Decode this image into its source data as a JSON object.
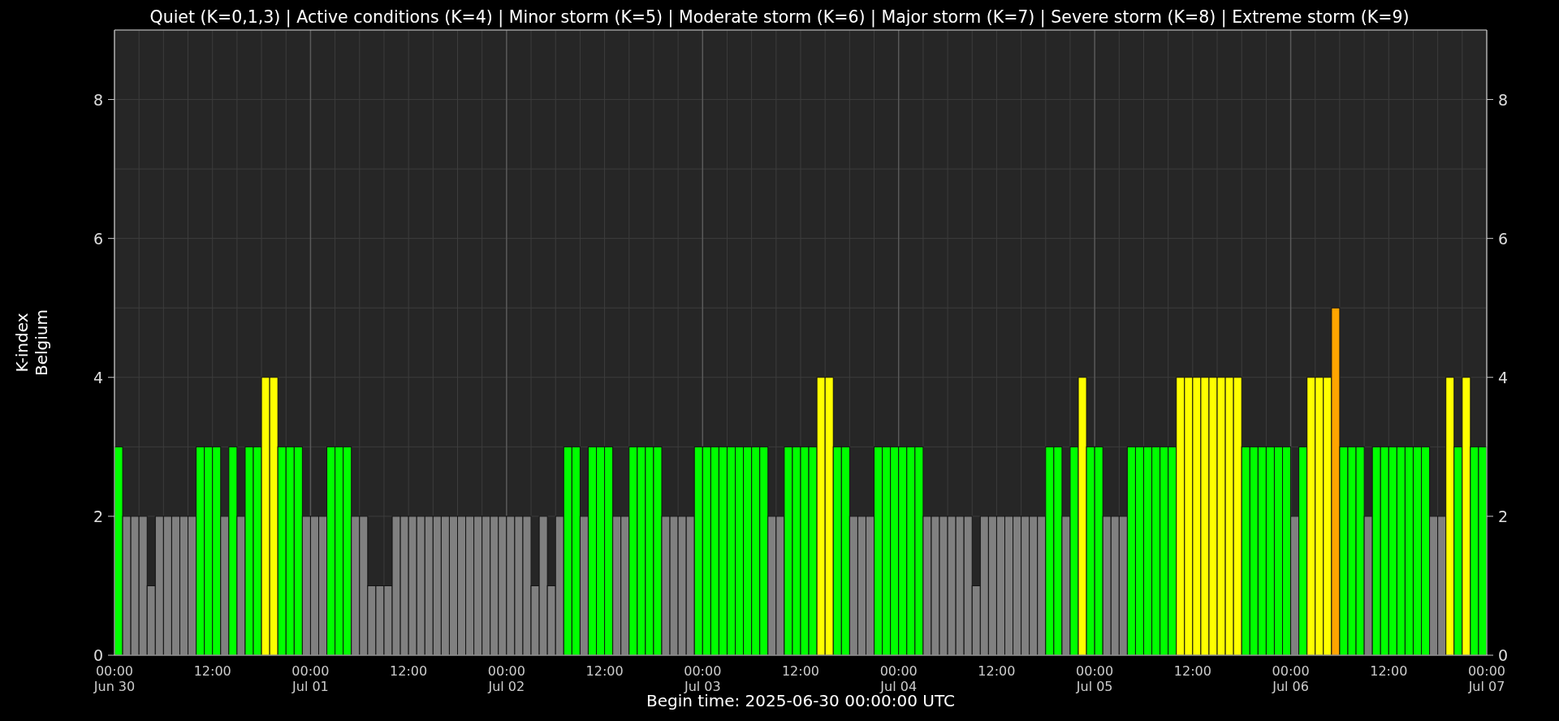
{
  "chart_data": {
    "type": "bar",
    "title": "Quiet (K=0,1,3) | Active conditions (K=4) | Minor storm (K=5) | Moderate storm (K=6) | Major storm (K=7) | Severe storm (K=8) | Extreme storm (K=9)",
    "xlabel": "Begin time: 2025-06-30 00:00:00 UTC",
    "ylabel": "K-index\nBelgium",
    "ylim": [
      0,
      9
    ],
    "grid": true,
    "categories": [
      "00:00\nJun 30",
      null,
      null,
      null,
      null,
      null,
      null,
      null,
      null,
      null,
      null,
      null,
      "12:00",
      null,
      null,
      null,
      null,
      null,
      null,
      null,
      null,
      null,
      null,
      null,
      "00:00\nJul 01",
      null,
      null,
      null,
      null,
      null,
      null,
      null,
      null,
      null,
      null,
      null,
      "12:00",
      null,
      null,
      null,
      null,
      null,
      null,
      null,
      null,
      null,
      null,
      null,
      "00:00\nJul 02",
      null,
      null,
      null,
      null,
      null,
      null,
      null,
      null,
      null,
      null,
      null,
      "12:00",
      null,
      null,
      null,
      null,
      null,
      null,
      null,
      null,
      null,
      null,
      null,
      "00:00\nJul 03",
      null,
      null,
      null,
      null,
      null,
      null,
      null,
      null,
      null,
      null,
      null,
      "12:00",
      null,
      null,
      null,
      null,
      null,
      null,
      null,
      null,
      null,
      null,
      null,
      "00:00\nJul 04",
      null,
      null,
      null,
      null,
      null,
      null,
      null,
      null,
      null,
      null,
      null,
      "12:00",
      null,
      null,
      null,
      null,
      null,
      null,
      null,
      null,
      null,
      null,
      null,
      "00:00\nJul 05",
      null,
      null,
      null,
      null,
      null,
      null,
      null,
      null,
      null,
      null,
      null,
      "12:00",
      null,
      null,
      null,
      null,
      null,
      null,
      null,
      null,
      null,
      null,
      null,
      "00:00\nJul 06",
      null,
      null,
      null,
      null,
      null,
      null,
      null,
      null,
      null,
      null,
      null,
      "12:00",
      null,
      null,
      null,
      null,
      null,
      null,
      null,
      null,
      null,
      null,
      null,
      "00:00\nJul 07"
    ],
    "yticks": [
      0,
      2,
      4,
      6,
      8
    ],
    "annotations": [
      "0",
      "2",
      "4",
      "6",
      "8"
    ],
    "series": [
      {
        "values": [
          3,
          2,
          2,
          2,
          1,
          2,
          2,
          2,
          2,
          2,
          3,
          3,
          3,
          2,
          3,
          2,
          3,
          3,
          4,
          4,
          3,
          3,
          3,
          2,
          2,
          2,
          3,
          3,
          3,
          2,
          2,
          1,
          1,
          1,
          2,
          2,
          2,
          2,
          2,
          2,
          2,
          2,
          2,
          2,
          2,
          2,
          2,
          2,
          2,
          2,
          2,
          1,
          2,
          1,
          2,
          3,
          3,
          2,
          3,
          3,
          3,
          2,
          2,
          3,
          3,
          3,
          3,
          2,
          2,
          2,
          2,
          3,
          3,
          3,
          3,
          3,
          3,
          3,
          3,
          3,
          2,
          2,
          3,
          3,
          3,
          3,
          4,
          4,
          3,
          3,
          2,
          2,
          2,
          3,
          3,
          3,
          3,
          3,
          3,
          2,
          2,
          2,
          2,
          2,
          2,
          1,
          2,
          2,
          2,
          2,
          2,
          2,
          2,
          2,
          3,
          3,
          2,
          3,
          4,
          3,
          3,
          2,
          2,
          2,
          3,
          3,
          3,
          3,
          3,
          3,
          4,
          4,
          4,
          4,
          4,
          4,
          4,
          4,
          3,
          3,
          3,
          3,
          3,
          3,
          2,
          3,
          4,
          4,
          4,
          5,
          3,
          3,
          3,
          2,
          3,
          3,
          3,
          3,
          3,
          3,
          3,
          2,
          2,
          4,
          3,
          4,
          3,
          3,
          null
        ]
      }
    ]
  }
}
